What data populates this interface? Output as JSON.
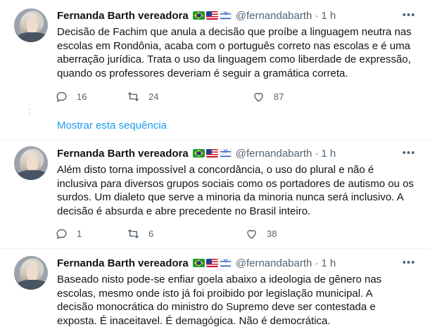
{
  "tweets": [
    {
      "name": "Fernanda Barth vereadora",
      "handle": "@fernandabarth",
      "separator": "·",
      "time": "1 h",
      "lines": [
        "Decisão de Fachim que anula a decisão que proíbe a linguagem neutra nas",
        "escolas em Rondônia, acaba com o português correto nas escolas e é uma",
        "aberração jurídica. Trata o uso da linguagem como liberdade de expressão,",
        "quando os professores deveriam é seguir a gramática correta."
      ],
      "replies": "16",
      "retweets": "24",
      "likes": "87"
    },
    {
      "name": "Fernanda Barth vereadora",
      "handle": "@fernandabarth",
      "separator": "·",
      "time": "1 h",
      "lines": [
        "Além disto torna impossível a concordância, o uso do plural e não é",
        "inclusiva para diversos grupos sociais como os portadores de autismo ou os",
        "surdos. Um dialeto que serve a minoria da minoria nunca será inclusivo. A",
        "decisão é absurda e abre precedente no Brasil inteiro."
      ],
      "replies": "1",
      "retweets": "6",
      "likes": "38"
    },
    {
      "name": "Fernanda Barth vereadora",
      "handle": "@fernandabarth",
      "separator": "·",
      "time": "1 h",
      "lines": [
        "Baseado nisto pode-se enfiar goela abaixo a ideologia de gênero nas",
        "escolas, mesmo onde isto já foi proibido por legislação municipal. A",
        "decisão monocrática do ministro do Supremo deve ser contestada e",
        "exposta. É inaceitavel. É demagógica. Não é democrática."
      ]
    }
  ],
  "show_thread_label": "Mostrar esta sequência",
  "flags": [
    "brazil-flag",
    "usa-flag",
    "israel-flag"
  ],
  "icons": [
    "more-icon",
    "reply-icon",
    "retweet-icon",
    "like-icon"
  ],
  "colors": {
    "link": "#1d9bf0",
    "secondary": "#536471",
    "text": "#0f1419",
    "thread": "#cfd9de"
  }
}
